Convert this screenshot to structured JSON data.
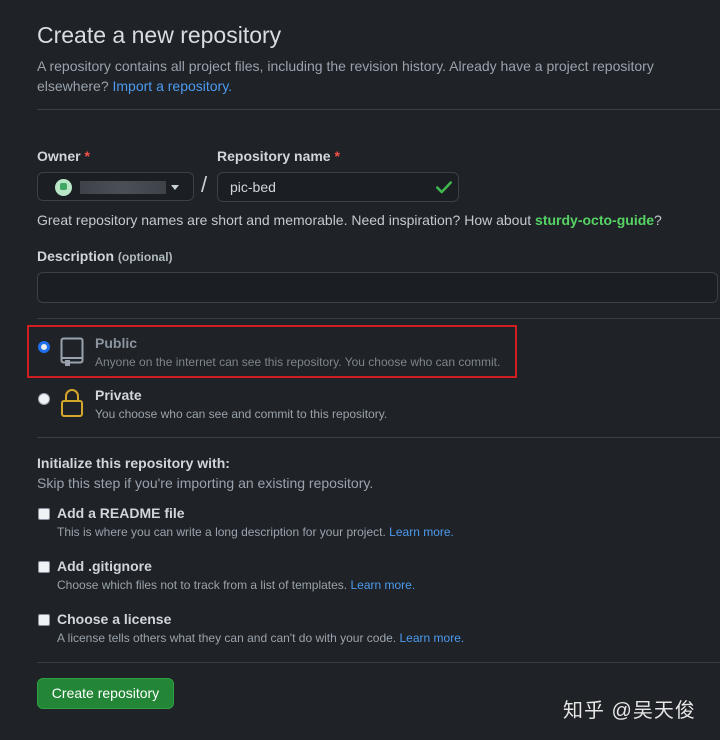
{
  "header": {
    "title": "Create a new repository",
    "subtitle": "A repository contains all project files, including the revision history. Already have a project repository elsewhere?",
    "import_link": "Import a repository."
  },
  "owner": {
    "label": "Owner",
    "required_mark": "*"
  },
  "repo_name": {
    "label": "Repository name",
    "required_mark": "*",
    "value": "pic-bed",
    "separator": "/",
    "valid_icon": "checkmark-icon"
  },
  "hint": {
    "prefix": "Great repository names are short and memorable. Need inspiration? How about ",
    "suggestion": "sturdy-octo-guide",
    "suffix": "?"
  },
  "description": {
    "label": "Description",
    "optional": "(optional)",
    "value": ""
  },
  "visibility": {
    "selected": "Public",
    "options": [
      {
        "title": "Public",
        "desc": "Anyone on the internet can see this repository. You choose who can commit.",
        "icon": "repo-book-icon"
      },
      {
        "title": "Private",
        "desc": "You choose who can see and commit to this repository.",
        "icon": "lock-icon"
      }
    ]
  },
  "init": {
    "title": "Initialize this repository with:",
    "subtitle": "Skip this step if you're importing an existing repository.",
    "items": [
      {
        "title": "Add a README file",
        "desc": "This is where you can write a long description for your project.",
        "link": "Learn more."
      },
      {
        "title": "Add .gitignore",
        "desc": "Choose which files not to track from a list of templates.",
        "link": "Learn more."
      },
      {
        "title": "Choose a license",
        "desc": "A license tells others what they can and can't do with your code.",
        "link": "Learn more."
      }
    ]
  },
  "submit": {
    "label": "Create repository"
  },
  "watermark": "知乎 @吴天俊",
  "colors": {
    "accent": "#238636",
    "link": "#4d9bf0",
    "suggestion": "#56d364",
    "required": "#f85149",
    "highlight": "#d01f23"
  }
}
